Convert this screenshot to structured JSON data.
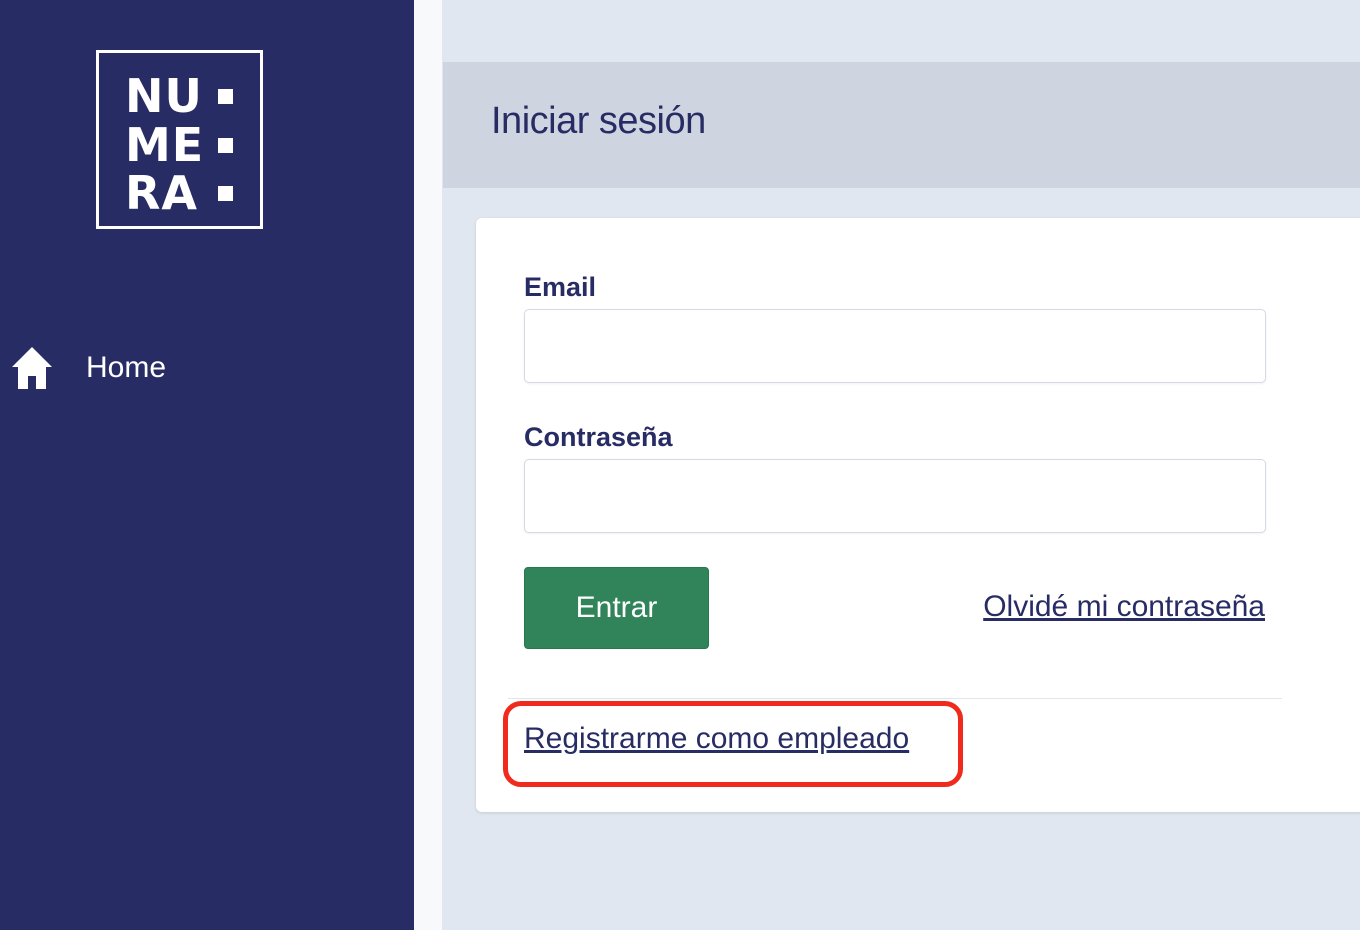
{
  "sidebar": {
    "logo": {
      "lines": [
        "NU",
        "ME",
        "RA"
      ]
    },
    "nav": {
      "home_label": "Home",
      "home_icon": "home-icon"
    }
  },
  "header": {
    "title": "Iniciar sesión"
  },
  "form": {
    "email_label": "Email",
    "email_value": "",
    "password_label": "Contraseña",
    "password_value": "",
    "submit_label": "Entrar",
    "forgot_link": "Olvidé mi contraseña",
    "register_link": "Registrarme como empleado"
  },
  "colors": {
    "sidebar_bg": "#282c64",
    "primary_text": "#282c64",
    "submit_bg": "#31845a",
    "highlight_border": "#f02b1d",
    "header_bg": "#ced5e0",
    "page_bg": "#e1e7f0"
  }
}
